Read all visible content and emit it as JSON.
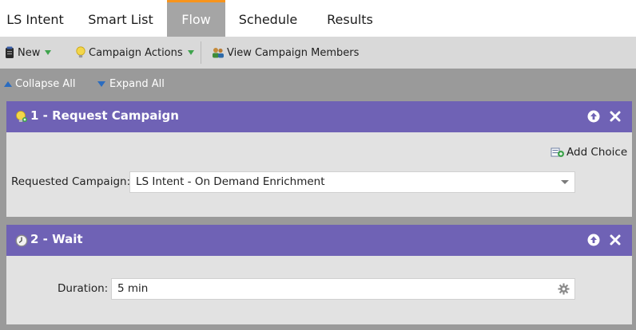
{
  "tabs": [
    {
      "label": "LS Intent"
    },
    {
      "label": "Smart List"
    },
    {
      "label": "Flow",
      "active": true
    },
    {
      "label": "Schedule"
    },
    {
      "label": "Results"
    }
  ],
  "toolbar": {
    "new_label": "New",
    "campaign_actions_label": "Campaign Actions",
    "view_members_label": "View Campaign Members"
  },
  "subbar": {
    "collapse_label": "Collapse All",
    "expand_label": "Expand All"
  },
  "steps": [
    {
      "title": "1 - Request Campaign",
      "add_choice_label": "Add Choice",
      "field_label": "Requested Campaign:",
      "field_value": "LS Intent - On Demand Enrichment"
    },
    {
      "title": "2 - Wait",
      "field_label": "Duration:",
      "field_value": "5 min"
    }
  ],
  "colors": {
    "active_tab_accent": "#f7941d",
    "step_header": "#6f62b5",
    "link_blue": "#2a6cc0"
  }
}
